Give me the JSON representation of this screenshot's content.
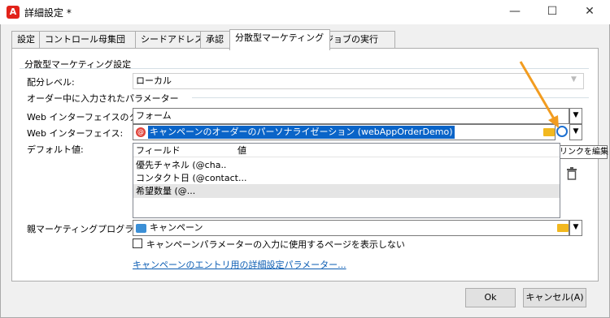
{
  "window": {
    "title": "詳細設定 *",
    "app_icon": "A",
    "minimize": "—",
    "maximize": "☐",
    "close": "✕"
  },
  "tabs": [
    {
      "label": "設定"
    },
    {
      "label": "コントロール母集団"
    },
    {
      "label": "シードアドレス"
    },
    {
      "label": "承認"
    },
    {
      "label": "分散型マーケティング"
    },
    {
      "label": "ジョブの実行"
    }
  ],
  "section": {
    "title": "分散型マーケティング設定",
    "distribution_level_label": "配分レベル:",
    "distribution_level_value": "ローカル",
    "order_params_title": "オーダー中に入力されたパラメーター",
    "web_type_label": "Web インターフェイスのタイプ:",
    "web_type_value": "フォーム",
    "web_interface_label": "Web インターフェイス:",
    "web_interface_value": "キャンペーンのオーダーのパーソナライゼーション (webAppOrderDemo)",
    "default_values_label": "デフォルト値:",
    "grid_headers": [
      "フィールド",
      "値"
    ],
    "grid_rows": [
      "優先チャネル (@cha..",
      "コンタクト日 (@contact...",
      "希望数量 (@..."
    ],
    "parent_program_label": "親マーケティングプログラム:",
    "parent_program_value": "キャンペーン",
    "checkbox_label": "キャンペーンパラメーターの入力に使用するページを表示しない",
    "advanced_link": "キャンペーンのエントリ用の詳細設定パラメーター...",
    "tooltip": "リンクを編集"
  },
  "footer": {
    "ok_label": "Ok",
    "cancel_label": "キャンセル(A)"
  },
  "colors": {
    "selection": "#0a64c8",
    "accent_arrow": "#f29c1f",
    "link": "#0a5cb3"
  }
}
